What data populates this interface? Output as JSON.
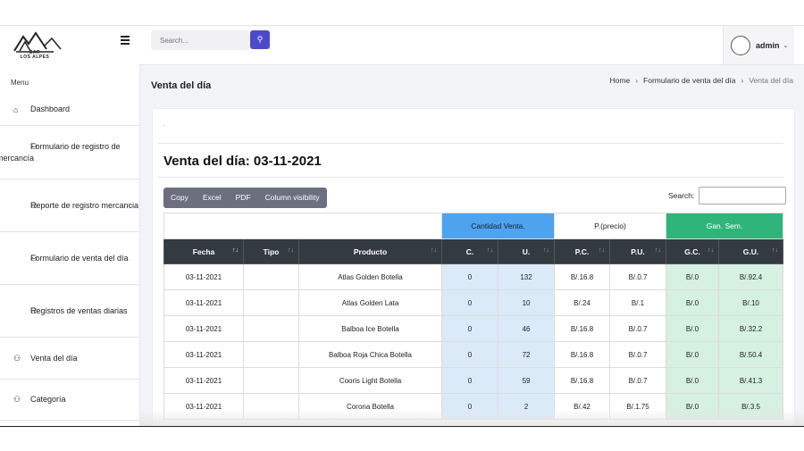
{
  "logo": {
    "text_line1": "BAR",
    "text_line2": "LOS ALPES"
  },
  "sidebar": {
    "menu_label": "Menu",
    "items": [
      {
        "label": "Dashboard",
        "icon": "home-icon"
      },
      {
        "label": "Formulario de registro de mercancía",
        "icon": "users-icon"
      },
      {
        "label": "Reporte de registro mercancia",
        "icon": "users-icon"
      },
      {
        "label": "Formulario de venta del día",
        "icon": "users-icon"
      },
      {
        "label": "Registros de ventas diarias",
        "icon": "users-icon"
      },
      {
        "label": "Venta del día",
        "icon": "users-icon"
      },
      {
        "label": "Categoría",
        "icon": "users-icon"
      }
    ]
  },
  "topbar": {
    "search_placeholder": "Search...",
    "user_name": "admin"
  },
  "page": {
    "title": "Venta del día",
    "breadcrumb": [
      "Home",
      "Formulario de venta del día",
      "Venta del día"
    ]
  },
  "card": {
    "dot": ".",
    "title": "Venta del día: 03-11-2021",
    "buttons": [
      "Copy",
      "Excel",
      "PDF",
      "Column visibility"
    ],
    "search_label": "Search:"
  },
  "table": {
    "group_headers": {
      "cantidad": "Cantidad Venta.",
      "precio": "P.(precio)",
      "ganancia": "Gan. Sem."
    },
    "columns": [
      "Fecha",
      "Tipo",
      "Producto",
      "C.",
      "U.",
      "P.C.",
      "P.U.",
      "G.C.",
      "G.U."
    ],
    "rows": [
      [
        "03-11-2021",
        "",
        "Atlas Golden Botella",
        "0",
        "132",
        "B/.16.8",
        "B/.0.7",
        "B/.0",
        "B/.92.4"
      ],
      [
        "03-11-2021",
        "",
        "Atlas Golden Lata",
        "0",
        "10",
        "B/.24",
        "B/.1",
        "B/.0",
        "B/.10"
      ],
      [
        "03-11-2021",
        "",
        "Balboa Ice Botella",
        "0",
        "46",
        "B/.16.8",
        "B/.0.7",
        "B/.0",
        "B/.32.2"
      ],
      [
        "03-11-2021",
        "",
        "Balboa Roja Chica Botella",
        "0",
        "72",
        "B/.16.8",
        "B/.0.7",
        "B/.0",
        "B/.50.4"
      ],
      [
        "03-11-2021",
        "",
        "Cooris Light Botella",
        "0",
        "59",
        "B/.16.8",
        "B/.0.7",
        "B/.0",
        "B/.41.3"
      ],
      [
        "03-11-2021",
        "",
        "Corona Botella",
        "0",
        "2",
        "B/.42",
        "B/.1.75",
        "B/.0",
        "B/.3.5"
      ]
    ]
  },
  "colors": {
    "accent": "#4a4acb",
    "cantidad": "#4ea3ef",
    "ganancia": "#2fb57a",
    "header_dark": "#333a42"
  }
}
